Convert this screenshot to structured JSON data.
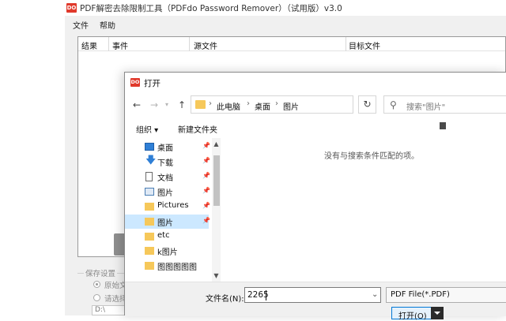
{
  "app": {
    "title": "PDF解密去除限制工具（PDFdo Password Remover）（试用版）v3.0",
    "logo": "DO",
    "menu": [
      "文件",
      "帮助"
    ],
    "columns": [
      "结果",
      "事件",
      "源文件",
      "目标文件"
    ],
    "save_group_label": "保存设置",
    "radio_original": "原始文",
    "radio_choose": "请选择",
    "path_value": "D:\\"
  },
  "dialog": {
    "title": "打开",
    "logo": "DO",
    "nav": {
      "back": "←",
      "forward": "→",
      "up": "↑"
    },
    "breadcrumb": [
      "此电脑",
      "桌面",
      "图片"
    ],
    "breadcrumb_sep": "›",
    "refresh": "↻",
    "search_placeholder": "搜索\"图片\"",
    "organize_label": "组织 ▾",
    "new_folder_label": "新建文件夹",
    "nav_items": [
      {
        "label": "桌面",
        "icon": "desktop-icon",
        "pinned": true
      },
      {
        "label": "下载",
        "icon": "download-icon",
        "pinned": true
      },
      {
        "label": "文档",
        "icon": "document-icon",
        "pinned": true
      },
      {
        "label": "图片",
        "icon": "pictures-icon",
        "pinned": true
      },
      {
        "label": "Pictures",
        "icon": "folder-icon",
        "pinned": true
      },
      {
        "label": "图片",
        "icon": "folder-icon",
        "pinned": true,
        "selected": true
      },
      {
        "label": "etc",
        "icon": "folder-icon",
        "pinned": false
      },
      {
        "label": "k图片",
        "icon": "folder-icon",
        "pinned": false
      },
      {
        "label": "图图图图图",
        "icon": "folder-icon",
        "pinned": false
      }
    ],
    "empty_message": "没有与搜索条件匹配的项。",
    "filename_label": "文件名(N):",
    "filename_value": "2265",
    "filetype_value": "PDF File(*.PDF)",
    "open_button": "打开(O)"
  },
  "colors": {
    "accent": "#0078d7",
    "selection": "#cce8ff",
    "folder": "#f6c85a",
    "logo_red": "#e0392b"
  }
}
